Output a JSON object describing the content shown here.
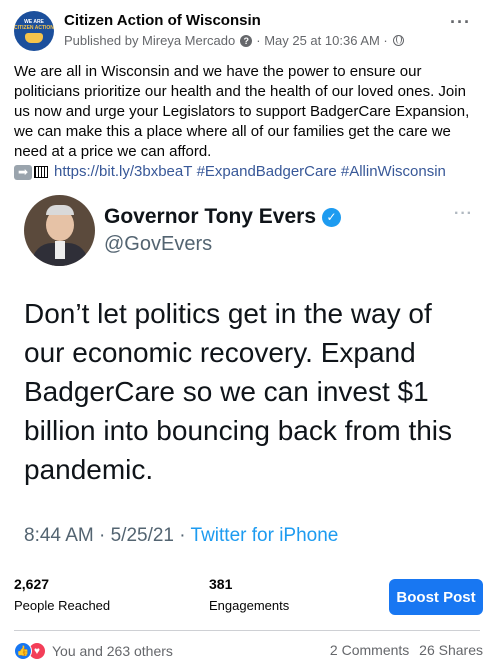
{
  "post": {
    "page_name": "Citizen Action of Wisconsin",
    "published_by": "Published by Mireya Mercado",
    "info_icon_glyph": "?",
    "date": "· May 25 at 10:36 AM ·",
    "more_glyph": "···",
    "text": "We are all in Wisconsin and we have the power to ensure our politicians prioritize our health and the health of our loved ones. Join us now and urge your Legislators to support BadgerCare Expansion, we can make this a place where all of our families get the care we need at a price we can afford.",
    "arrow_glyph": "➡",
    "link": "https://bit.ly/3bxbeaT",
    "hashtag_1": "#ExpandBadgerCare",
    "hashtag_2": "#AllinWisconsin",
    "avatar_text_1": "WE ARE",
    "avatar_text_2": "CITIZEN ACTION"
  },
  "tweet": {
    "name": "Governor Tony Evers",
    "verified_glyph": "✓",
    "handle": "@GovEvers",
    "more_glyph": "···",
    "body": "Don’t let politics get in the way of our economic recovery. Expand BadgerCare so we can invest $1 billion into bouncing back from this pandemic.",
    "time": "8:44 AM · 5/25/21 · ",
    "source": "Twitter for iPhone"
  },
  "insights": {
    "reached_value": "2,627",
    "reached_label": "People Reached",
    "engagements_value": "381",
    "engagements_label": "Engagements",
    "boost_label": "Boost Post"
  },
  "reactions": {
    "like_glyph": "👍",
    "love_glyph": "♥",
    "text": "You and 263 others",
    "comments": "2 Comments",
    "shares": "26 Shares"
  },
  "colors": {
    "accent": "#1877f2",
    "link": "#385898",
    "twitter_blue": "#1d9bf0"
  }
}
